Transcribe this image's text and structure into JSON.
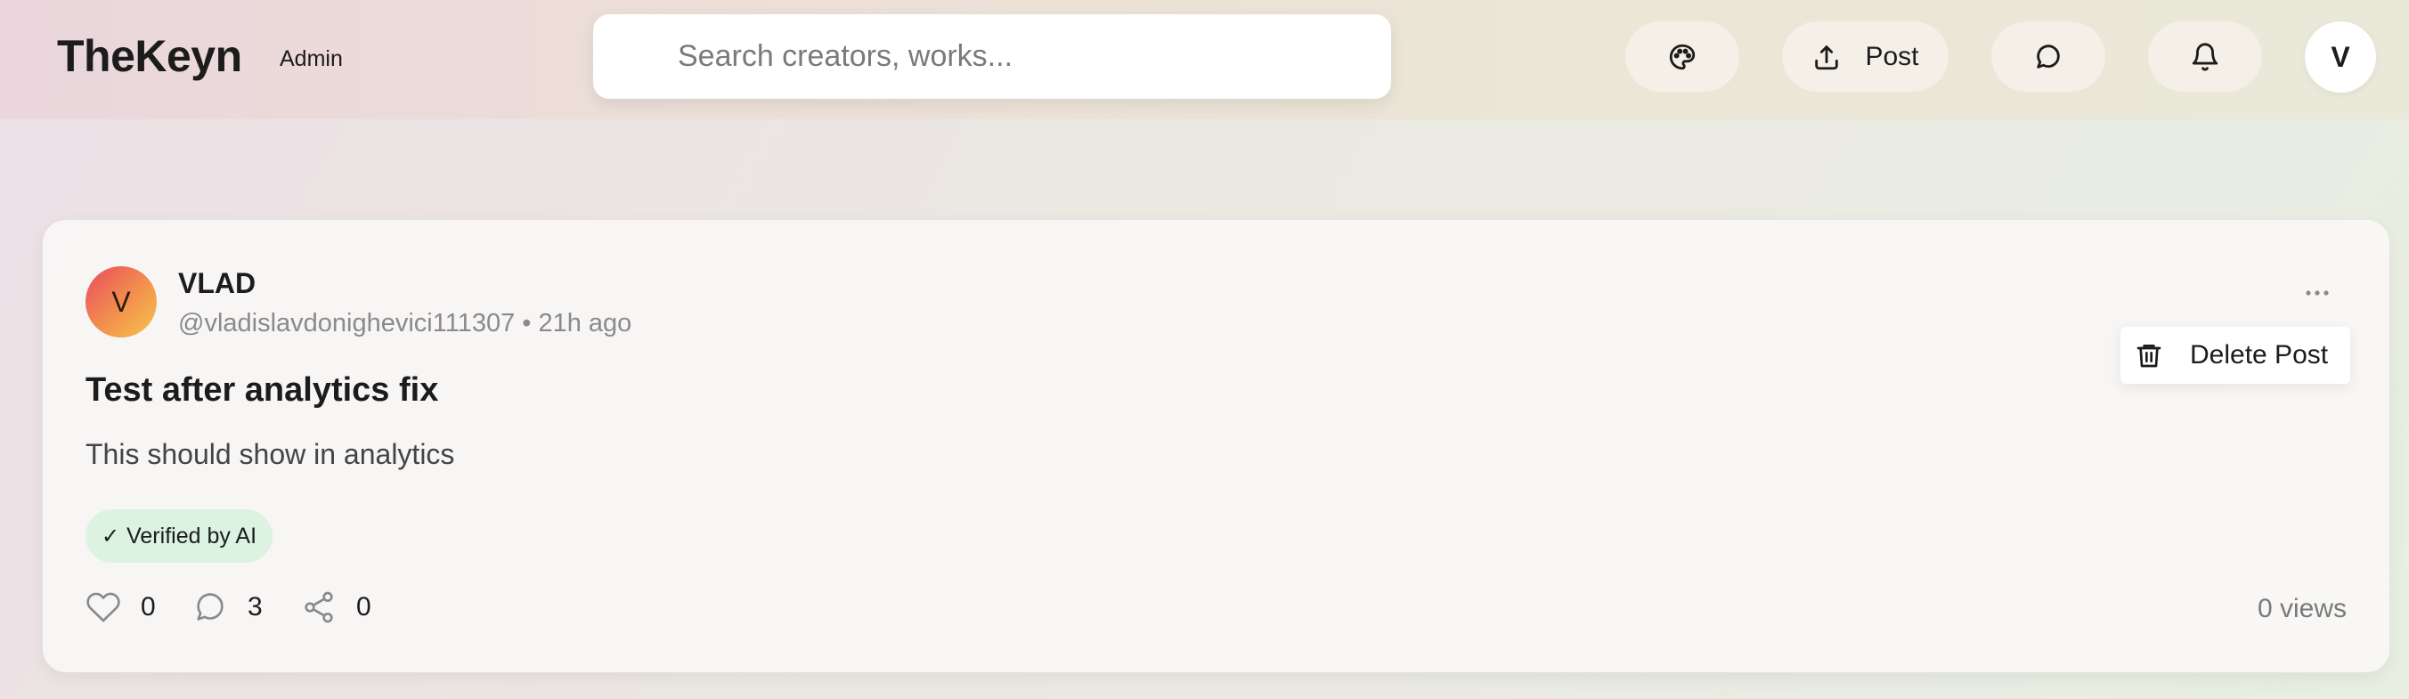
{
  "header": {
    "brand": "TheKeyn",
    "role_badge": "Admin",
    "search": {
      "placeholder": "Search creators, works...",
      "value": ""
    },
    "buttons": {
      "theme": {
        "icon": "palette-icon"
      },
      "post": {
        "icon": "upload-icon",
        "label": "Post"
      },
      "messages": {
        "icon": "chat-icon"
      },
      "notifications": {
        "icon": "bell-icon"
      }
    },
    "avatar_initial": "V"
  },
  "post": {
    "avatar_initial": "V",
    "author_name": "VLAD",
    "author_handle_time": "@vladislavdonighevici111307 • 21h ago",
    "more_icon": "more-horizontal-icon",
    "menu": {
      "delete_label": "Delete Post",
      "delete_icon": "trash-icon"
    },
    "title": "Test after analytics fix",
    "body": "This should show in analytics",
    "badge": {
      "check": "✓",
      "label": "Verified by AI"
    },
    "actions": {
      "likes": "0",
      "comments": "3",
      "shares": "0"
    },
    "views": "0 views"
  },
  "colors": {
    "avatar_gradient": [
      "#e94a5e",
      "#f28b4f",
      "#f6c64a"
    ],
    "verified_bg": "#dcf3e2",
    "admin_badge_bg": "#ecd9da"
  }
}
